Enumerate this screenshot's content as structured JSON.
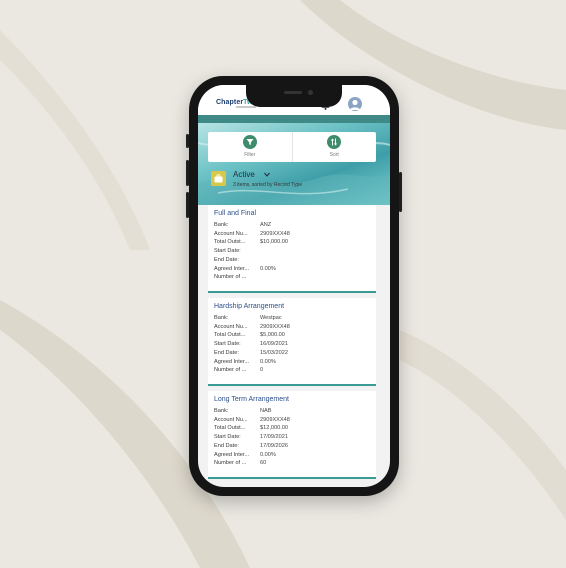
{
  "app": {
    "logo_main": "Chapter",
    "logo_accent": "Two"
  },
  "actions": [
    {
      "label": "Filter",
      "icon": "filter-icon"
    },
    {
      "label": "Sort",
      "icon": "sort-icon"
    }
  ],
  "list_view": {
    "title": "Active",
    "subtitle": "3 items, sorted by Record Type",
    "icon": "briefcase-icon"
  },
  "records": [
    {
      "title": "Full and Final",
      "fields": [
        {
          "label": "Bank:",
          "value": "ANZ"
        },
        {
          "label": "Account Nu...",
          "value": "2909XXX48"
        },
        {
          "label": "Total Outst...",
          "value": "$10,000.00"
        },
        {
          "label": "Start Date:",
          "value": ""
        },
        {
          "label": "End Date:",
          "value": ""
        },
        {
          "label": "Agreed Inter...",
          "value": "0.00%"
        },
        {
          "label": "Number of ...",
          "value": ""
        }
      ]
    },
    {
      "title": "Hardship Arrangement",
      "fields": [
        {
          "label": "Bank:",
          "value": "Westpac"
        },
        {
          "label": "Account Nu...",
          "value": "2909XXX48"
        },
        {
          "label": "Total Outst...",
          "value": "$5,000.00"
        },
        {
          "label": "Start Date:",
          "value": "16/09/2021"
        },
        {
          "label": "End Date:",
          "value": "15/03/2022"
        },
        {
          "label": "Agreed Inter...",
          "value": "0.00%"
        },
        {
          "label": "Number of ...",
          "value": "0"
        }
      ]
    },
    {
      "title": "Long Term Arrangement",
      "fields": [
        {
          "label": "Bank:",
          "value": "NAB"
        },
        {
          "label": "Account Nu...",
          "value": "2909XXX48"
        },
        {
          "label": "Total Outst...",
          "value": "$12,000.00"
        },
        {
          "label": "Start Date:",
          "value": "17/09/2021"
        },
        {
          "label": "End Date:",
          "value": "17/09/2026"
        },
        {
          "label": "Agreed Inter...",
          "value": "0.00%"
        },
        {
          "label": "Number of ...",
          "value": "60"
        }
      ]
    }
  ],
  "colors": {
    "background": "#ebe8e1",
    "brand_navy": "#1c3f6e",
    "brand_teal": "#3aa8a0",
    "action_green": "#3e8c6c",
    "title_blue": "#2c4f8c"
  }
}
